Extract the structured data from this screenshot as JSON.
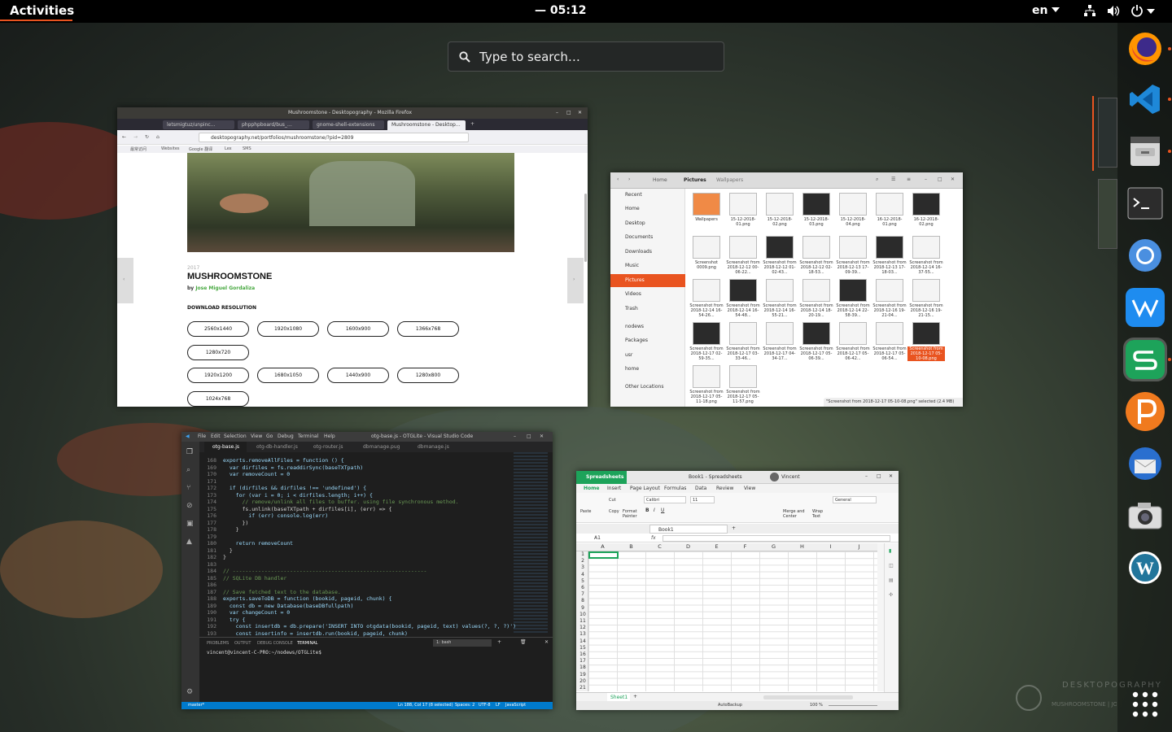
{
  "topbar": {
    "activities": "Activities",
    "clock": "— 05:12",
    "lang": "en"
  },
  "search": {
    "placeholder": "Type to search…"
  },
  "firefox": {
    "title": "Mushroomstone - Desktopography - Mozilla Firefox",
    "tabs": [
      "letsmigtuz/unpinc...",
      "phpphpboard/bus_…",
      "gnome-shell-extensions",
      "Mushroomstone - Desktop…"
    ],
    "url": "desktopography.net/portfolios/mushroomstone/?pid=2809",
    "bookmarks": [
      "最常访问",
      "Websites",
      "Google 翻译",
      "Lex",
      "SMS"
    ],
    "year": "2017",
    "heading": "MUSHROOMSTONE",
    "by": "by",
    "author": "Jose Miguel Gordaliza",
    "download_label": "DOWNLOAD RESOLUTION",
    "resolutions_row1": [
      "2560x1440",
      "1920x1080",
      "1600x900",
      "1366x768"
    ],
    "resolutions_row2": [
      "1280x720"
    ],
    "resolutions_row3": [
      "1920x1200",
      "1680x1050",
      "1440x900",
      "1280x800"
    ],
    "resolutions_row4": [
      "1024x768"
    ]
  },
  "files": {
    "path": [
      "Home",
      "Pictures",
      "Wallpapers"
    ],
    "sidebar": [
      "Recent",
      "Home",
      "Desktop",
      "Documents",
      "Downloads",
      "Music",
      "Pictures",
      "Videos",
      "Trash",
      "nodews",
      "Packages",
      "usr",
      "home",
      "Other Locations"
    ],
    "items": [
      "Wallpapers",
      "15-12-2018-01.png",
      "15-12-2018-02.png",
      "15-12-2018-03.png",
      "15-12-2018-04.png",
      "16-12-2018-01.png",
      "16-12-2018-02.png",
      "Screenshot 0009.png",
      "Screenshot from 2018-12-12 00-06-22...",
      "Screenshot from 2018-12-12 01-02-43...",
      "Screenshot from 2018-12-12 02-18-53...",
      "Screenshot from 2018-12-13 17-09-39...",
      "Screenshot from 2018-12-13 17-18-03...",
      "Screenshot from 2018-12-14 16-37-55...",
      "Screenshot from 2018-12-14 16-54-26...",
      "Screenshot from 2018-12-14 16-54-48...",
      "Screenshot from 2018-12-14 16-55-21...",
      "Screenshot from 2018-12-14 18-20-19...",
      "Screenshot from 2018-12-14 22-58-39...",
      "Screenshot from 2018-12-16 19-21-04...",
      "Screenshot from 2018-12-16 19-21-15...",
      "Screenshot from 2018-12-17 02-59-35...",
      "Screenshot from 2018-12-17 03-33-46...",
      "Screenshot from 2018-12-17 04-34-17...",
      "Screenshot from 2018-12-17 05-06-39...",
      "Screenshot from 2018-12-17 05-06-42...",
      "Screenshot from 2018-12-17 05-06-54...",
      "Screenshot from 2018-12-17 05-10-08.png",
      "Screenshot from 2018-12-17 05-11-18.png",
      "Screenshot from 2018-12-17 05-11-57.png"
    ],
    "status": "\"Screenshot from 2018-12-17 05-10-08.png\" selected (2.4 MB)"
  },
  "vscode": {
    "title": "otg-base.js - OTGLite - Visual Studio Code",
    "menu": [
      "File",
      "Edit",
      "Selection",
      "View",
      "Go",
      "Debug",
      "Terminal",
      "Help"
    ],
    "tabs": [
      "otg-base.js",
      "otg-db-handler.js",
      "otg-router.js",
      "dbmanage.pug",
      "dbmanage.js"
    ],
    "lines": [
      "168",
      "169",
      "170",
      "171",
      "172",
      "173",
      "174",
      "175",
      "176",
      "177",
      "178",
      "179",
      "180",
      "181",
      "182",
      "183",
      "184",
      "185",
      "186",
      "187",
      "188",
      "189",
      "190",
      "191",
      "192",
      "193"
    ],
    "code": [
      "exports.removeAllFiles = function () {",
      "  var dirfiles = fs.readdirSync(baseTXTpath)",
      "  var removeCount = 0",
      "",
      "  if (dirfiles && dirfiles !== 'undefined') {",
      "    for (var i = 0; i < dirfiles.length; i++) {",
      "      // remove/unlink all files to buffer. using file synchronous method.",
      "      fs.unlink(baseTXTpath + dirfiles[i], (err) => {",
      "        if (err) console.log(err)",
      "      })",
      "    }",
      "",
      "    return removeCount",
      "  }",
      "}",
      "",
      "// -------------------------------------------------------------",
      "// SQLite DB handler",
      "",
      "// Save fetched text to the database.",
      "exports.saveToDB = function (bookid, pageid, chunk) {",
      "  const db = new Database(baseDBfullpath)",
      "  var changeCount = 0",
      "  try {",
      "    const insertdb = db.prepare('INSERT INTO otgdata(bookid, pageid, text) values(?, ?, ?)')",
      "    const insertinfo = insertdb.run(bookid, pageid, chunk)"
    ],
    "panel_tabs": [
      "PROBLEMS",
      "OUTPUT",
      "DEBUG CONSOLE",
      "TERMINAL"
    ],
    "terminal_select": "1: bash",
    "prompt": "vincent@vincent-C-PRO:~/nodews/OTGLite$",
    "status_left": "master*",
    "status_right": [
      "Ln 188, Col 17 (8 selected)",
      "Spaces: 2",
      "UTF-8",
      "LF",
      "JavaScript"
    ]
  },
  "sheets": {
    "app": "Spreadsheets",
    "title": "Book1 - Spreadsheets",
    "user": "Vincent",
    "ribbon_tabs": [
      "Home",
      "Insert",
      "Page Layout",
      "Formulas",
      "Data",
      "Review",
      "View"
    ],
    "font": "Calibri",
    "size": "11",
    "number_format": "General",
    "buttons": [
      "Paste",
      "Cut",
      "Copy",
      "Format Painter",
      "Merge and Center",
      "Wrap Text"
    ],
    "doc_tab": "Book1",
    "cell": "A1",
    "fx": "fx",
    "cols": [
      "A",
      "B",
      "C",
      "D",
      "E",
      "F",
      "G",
      "H",
      "I",
      "J"
    ],
    "rows": [
      "1",
      "2",
      "3",
      "4",
      "5",
      "6",
      "7",
      "8",
      "9",
      "10",
      "11",
      "12",
      "13",
      "14",
      "15",
      "16",
      "17",
      "18",
      "19",
      "20",
      "21"
    ],
    "sheet_tab": "Sheet1",
    "autobackup": "AutoBackup",
    "zoom": "100 %"
  },
  "watermark": {
    "brand": "DESKTOPOGRAPHY",
    "sub": "MUSHROOMSTONE | JOSE MIGUEL"
  },
  "dock": [
    "firefox-icon",
    "vscode-icon",
    "files-cabinet-icon",
    "terminal-icon",
    "chromium-icon",
    "wps-writer-icon",
    "wps-spreadsheets-icon",
    "wps-presentation-icon",
    "thunderbird-icon",
    "screenshot-camera-icon",
    "wordpress-icon",
    "show-applications-icon"
  ]
}
